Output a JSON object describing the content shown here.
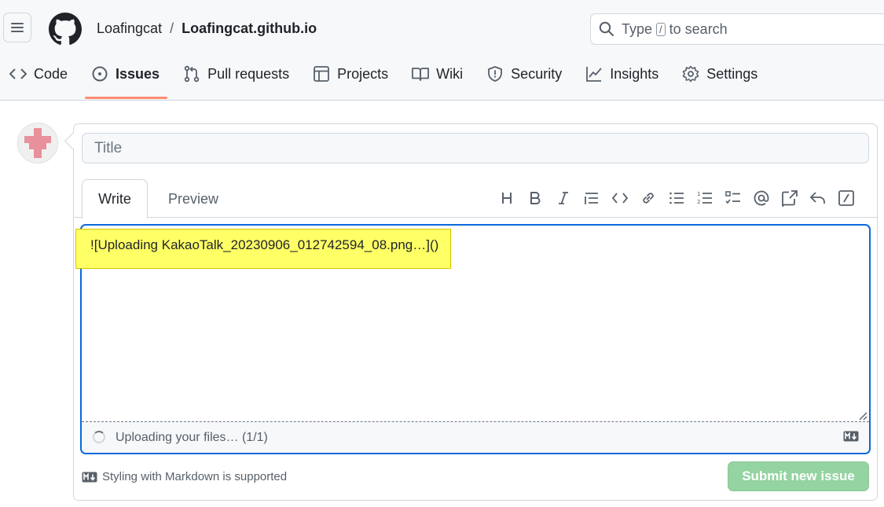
{
  "header": {
    "owner": "Loafingcat",
    "separator": "/",
    "repo": "Loafingcat.github.io",
    "search": {
      "prefix": "Type",
      "key": "/",
      "suffix": "to search"
    }
  },
  "tabs": [
    {
      "label": "Code",
      "icon": "code-icon"
    },
    {
      "label": "Issues",
      "icon": "issue-opened-icon",
      "active": true
    },
    {
      "label": "Pull requests",
      "icon": "git-pull-request-icon"
    },
    {
      "label": "Projects",
      "icon": "table-icon"
    },
    {
      "label": "Wiki",
      "icon": "book-icon"
    },
    {
      "label": "Security",
      "icon": "shield-icon"
    },
    {
      "label": "Insights",
      "icon": "graph-icon"
    },
    {
      "label": "Settings",
      "icon": "gear-icon"
    }
  ],
  "form": {
    "title_placeholder": "Title",
    "write_tab": "Write",
    "preview_tab": "Preview",
    "body_value": "![Uploading KakaoTalk_20230906_012742594_08.png…]()",
    "uploading_text": "Uploading your files… (1/1)",
    "markdown_note": "Styling with Markdown is supported",
    "submit_label": "Submit new issue"
  },
  "toolbar_icons": [
    "heading-icon",
    "bold-icon",
    "italic-icon",
    "quote-icon",
    "code-icon",
    "link-icon",
    "unordered-list-icon",
    "ordered-list-icon",
    "task-list-icon",
    "mention-icon",
    "cross-reference-icon",
    "reply-icon",
    "slash-command-icon"
  ],
  "colors": {
    "accent_blue": "#0969da",
    "tab_underline": "#fd8c73",
    "submit_disabled": "#94d3a2",
    "highlight": "#ffff66"
  }
}
